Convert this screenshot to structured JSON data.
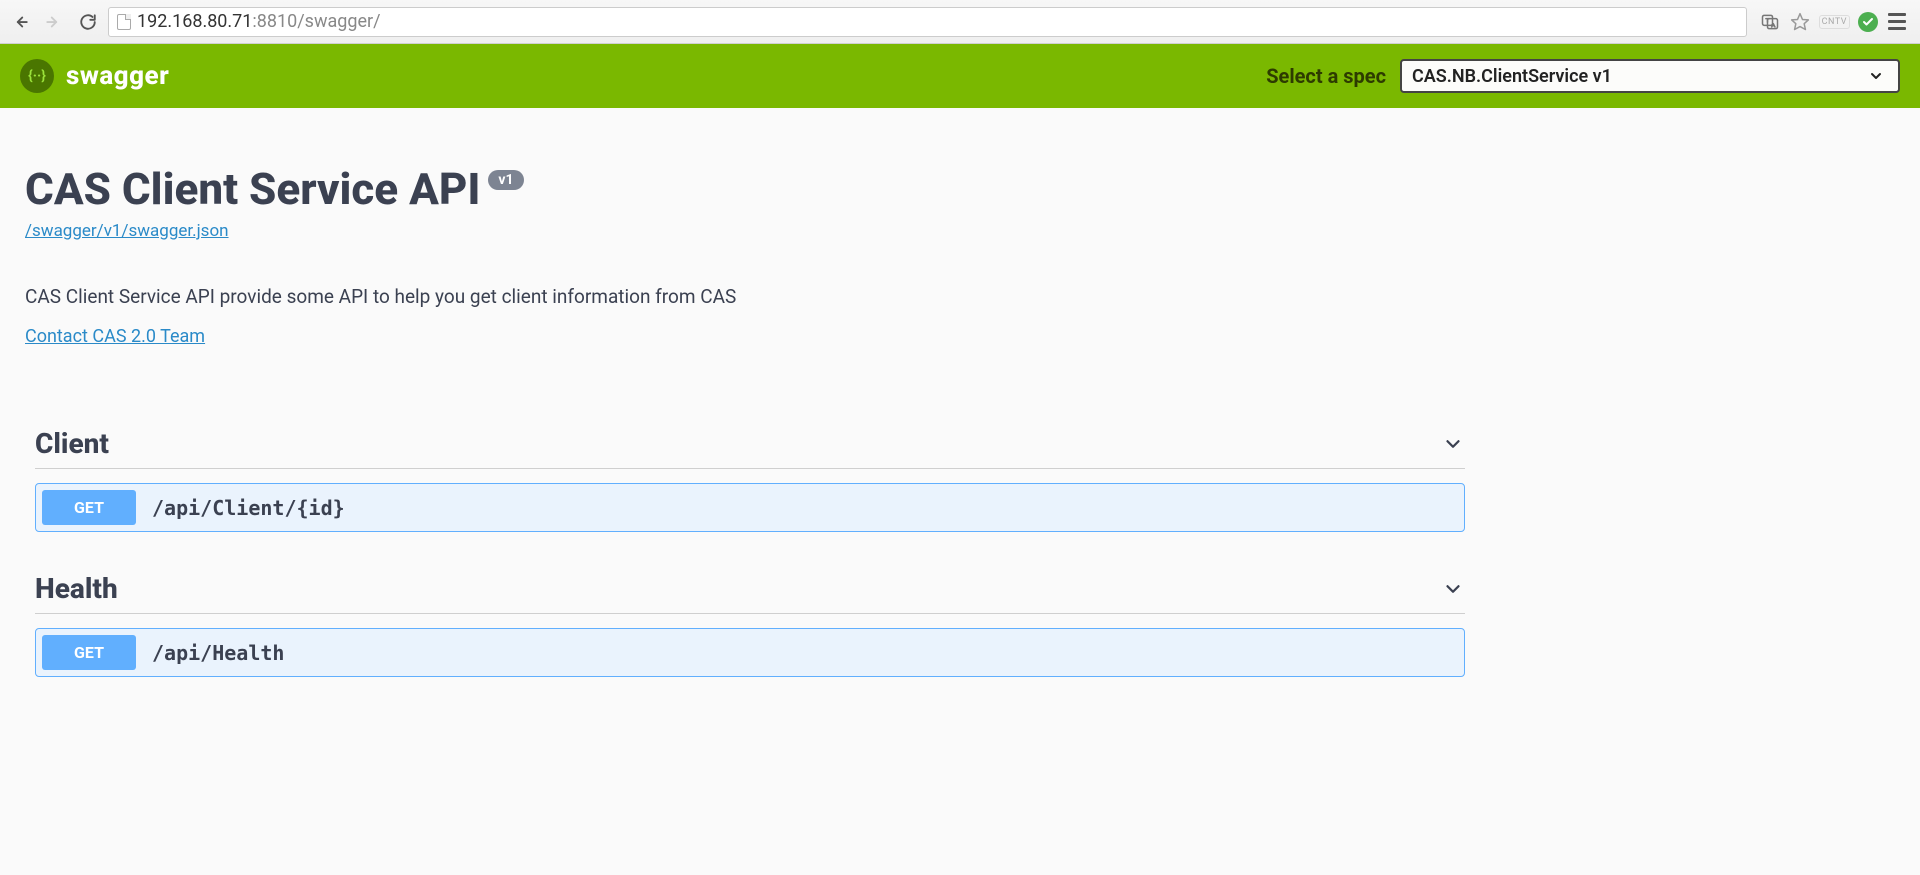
{
  "browser": {
    "url_host": "192.168.80.71",
    "url_rest": ":8810/swagger/",
    "ext_label": "CNTV"
  },
  "topbar": {
    "brand": "swagger",
    "spec_label": "Select a spec",
    "spec_selected": "CAS.NB.ClientService v1"
  },
  "info": {
    "title": "CAS Client Service API",
    "version": "v1",
    "json_link": "/swagger/v1/swagger.json",
    "description": "CAS Client Service API provide some API to help you get client information from CAS",
    "contact_label": "Contact CAS 2.0 Team"
  },
  "tags": [
    {
      "name": "Client",
      "operations": [
        {
          "method": "GET",
          "path": "/api/Client/{id}"
        }
      ]
    },
    {
      "name": "Health",
      "operations": [
        {
          "method": "GET",
          "path": "/api/Health"
        }
      ]
    }
  ]
}
